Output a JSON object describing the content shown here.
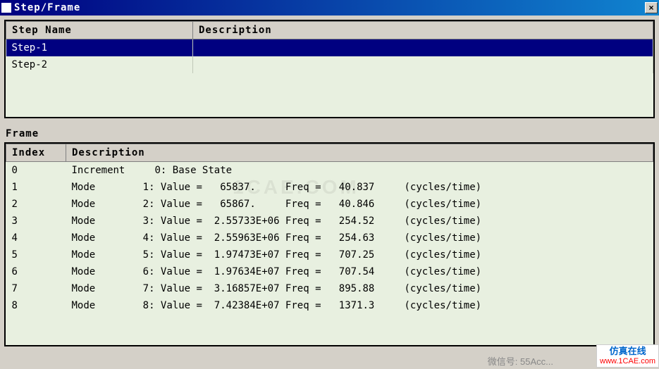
{
  "window": {
    "title": "Step/Frame",
    "close": "×"
  },
  "stepTable": {
    "headers": {
      "name": "Step Name",
      "desc": "Description"
    },
    "rows": [
      {
        "name": "Step-1",
        "desc": "",
        "selected": true
      },
      {
        "name": "Step-2",
        "desc": "",
        "selected": false
      }
    ]
  },
  "frameSection": {
    "label": "Frame"
  },
  "frameTable": {
    "headers": {
      "index": "Index",
      "desc": "Description"
    },
    "rows": [
      {
        "index": "0",
        "desc": "Increment     0: Base State"
      },
      {
        "index": "1",
        "desc": "Mode        1: Value =   65837.     Freq =   40.837     (cycles/time)"
      },
      {
        "index": "2",
        "desc": "Mode        2: Value =   65867.     Freq =   40.846     (cycles/time)"
      },
      {
        "index": "3",
        "desc": "Mode        3: Value =  2.55733E+06 Freq =   254.52     (cycles/time)"
      },
      {
        "index": "4",
        "desc": "Mode        4: Value =  2.55963E+06 Freq =   254.63     (cycles/time)"
      },
      {
        "index": "5",
        "desc": "Mode        5: Value =  1.97473E+07 Freq =   707.25     (cycles/time)"
      },
      {
        "index": "6",
        "desc": "Mode        6: Value =  1.97634E+07 Freq =   707.54     (cycles/time)"
      },
      {
        "index": "7",
        "desc": "Mode        7: Value =  3.16857E+07 Freq =   895.88     (cycles/time)"
      },
      {
        "index": "8",
        "desc": "Mode        8: Value =  7.42384E+07 Freq =   1371.3     (cycles/time)"
      }
    ]
  },
  "watermark": "1CAE.COM",
  "overlayText": "微信号: 55Acc...",
  "badge": {
    "line1": "仿真在线",
    "line2": "www.1CAE.com"
  }
}
